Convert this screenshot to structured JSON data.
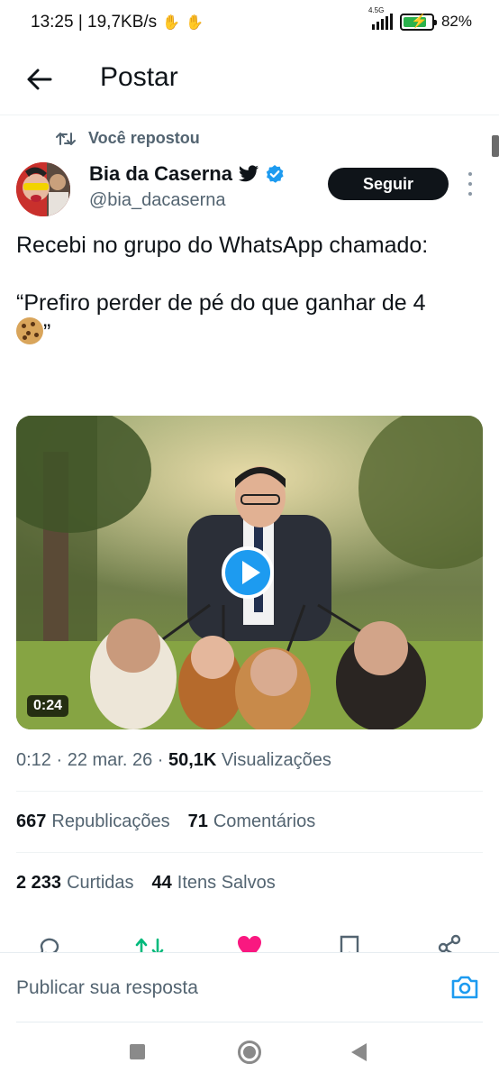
{
  "status_bar": {
    "time_speed": "13:25 | 19,7KB/s",
    "network": "4.5G",
    "battery_percent": 82,
    "battery_label": "82%"
  },
  "header": {
    "back_icon": "arrow-left-icon",
    "title": "Postar"
  },
  "tweet": {
    "repost_label": "Você repostou",
    "author_name": "Bia da Caserna",
    "author_handle": "@bia_dacaserna",
    "follow_label": "Seguir",
    "text_line1": "Recebi no grupo do WhatsApp chamado:",
    "text_line2": "“Prefiro perder de pé do que ganhar de 4",
    "text_line2_end": "”",
    "video_duration": "0:24",
    "timestamp": "0:12 · 22 mar. 26 · ",
    "views_count": "50,1K",
    "views_label": "Visualizações",
    "reposts_count": "667",
    "reposts_label": "Republicações",
    "comments_count": "71",
    "comments_label": "Comentários",
    "likes_count": "2 233",
    "likes_label": "Curtidas",
    "saves_count": "44",
    "saves_label": "Itens Salvos"
  },
  "reply": {
    "placeholder": "Publicar sua resposta",
    "camera_icon": "camera-icon"
  },
  "colors": {
    "accent": "#1d9bf0",
    "text_primary": "#0f1419",
    "text_secondary": "#536471",
    "like": "#f91880",
    "repost": "#00ba7c"
  }
}
